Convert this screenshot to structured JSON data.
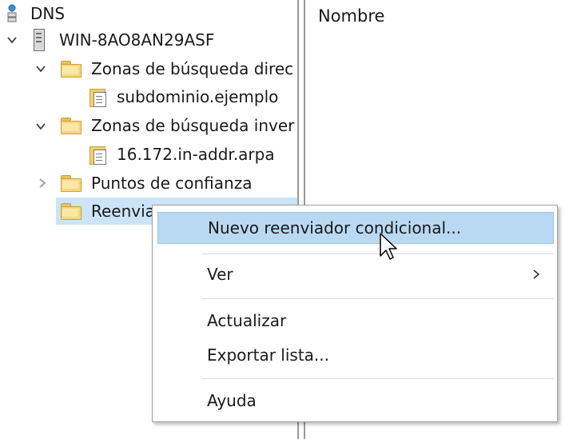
{
  "tree": {
    "root": {
      "label": "DNS",
      "icon": "dns-server-icon"
    },
    "server": {
      "label": "WIN-8AO8AN29ASF",
      "icon": "server-icon"
    },
    "nodes": [
      {
        "label": "Zonas de búsqueda direc",
        "icon": "folder-icon",
        "state": "expanded"
      },
      {
        "label": "subdominio.ejemplo",
        "icon": "zone-file-icon"
      },
      {
        "label": "Zonas de búsqueda inver",
        "icon": "folder-icon",
        "state": "expanded"
      },
      {
        "label": "16.172.in-addr.arpa",
        "icon": "zone-file-icon"
      },
      {
        "label": "Puntos de confianza",
        "icon": "folder-icon",
        "state": "collapsed"
      },
      {
        "label": "Reenvia",
        "icon": "folder-icon",
        "state": "selected"
      }
    ]
  },
  "right_pane": {
    "column_header": "Nombre"
  },
  "context_menu": {
    "items": [
      {
        "label": "Nuevo reenviador condicional...",
        "highlighted": true
      },
      {
        "label": "Ver",
        "submenu": true
      },
      {
        "label": "Actualizar"
      },
      {
        "label": "Exportar lista..."
      },
      {
        "label": "Ayuda"
      }
    ]
  },
  "colors": {
    "selection": "#cce4f7",
    "menu_highlight": "#b9d9f2",
    "folder": "#f6d77a"
  }
}
